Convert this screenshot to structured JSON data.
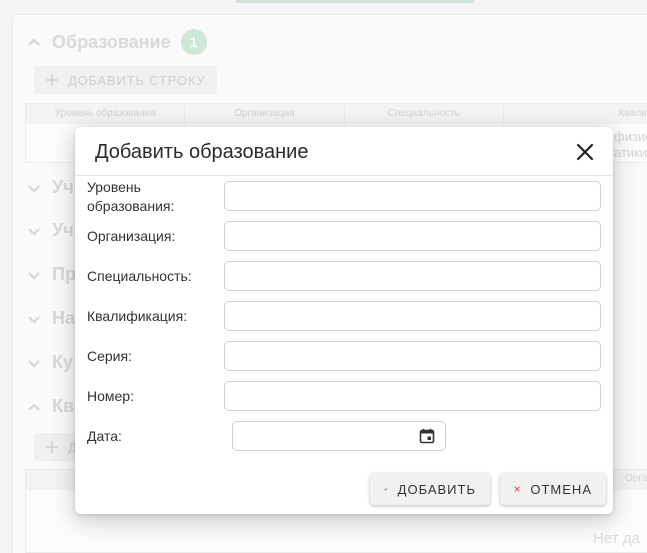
{
  "background": {
    "section_title": "Образование",
    "section_count": "1",
    "add_row_label": "ДОБАВИТЬ СТРОКУ",
    "table_headers": [
      "Уровень образования",
      "Организация",
      "Специальность",
      "Квалиф"
    ],
    "cell_fragment_1": "физис",
    "cell_fragment_2": "атики",
    "collapsed_sections": [
      "Уч",
      "Уч",
      "Пр",
      "На",
      "Ку",
      "Кв"
    ],
    "add_button_fragment": "Д",
    "table2_header_fragment": "Орга",
    "no_data_fragment": "Нет да"
  },
  "modal": {
    "title": "Добавить образование",
    "fields": [
      {
        "label": "Уровень образования:",
        "value": ""
      },
      {
        "label": "Организация:",
        "value": ""
      },
      {
        "label": "Специальность:",
        "value": ""
      },
      {
        "label": "Квалификация:",
        "value": ""
      },
      {
        "label": "Серия:",
        "value": ""
      },
      {
        "label": "Номер:",
        "value": ""
      }
    ],
    "date_label": "Дата:",
    "date_value": "",
    "add_label": "ДОБАВИТЬ",
    "cancel_label": "ОТМЕНА"
  },
  "colors": {
    "accent_green": "#2e7d32",
    "cancel_red": "#e53935",
    "badge_green": "#cfe7d6"
  },
  "icons": {
    "close": "close-icon",
    "calendar": "calendar-icon",
    "add": "check-icon",
    "cancel": "x-icon",
    "expand": "chevron-icon",
    "plus": "plus-icon"
  }
}
